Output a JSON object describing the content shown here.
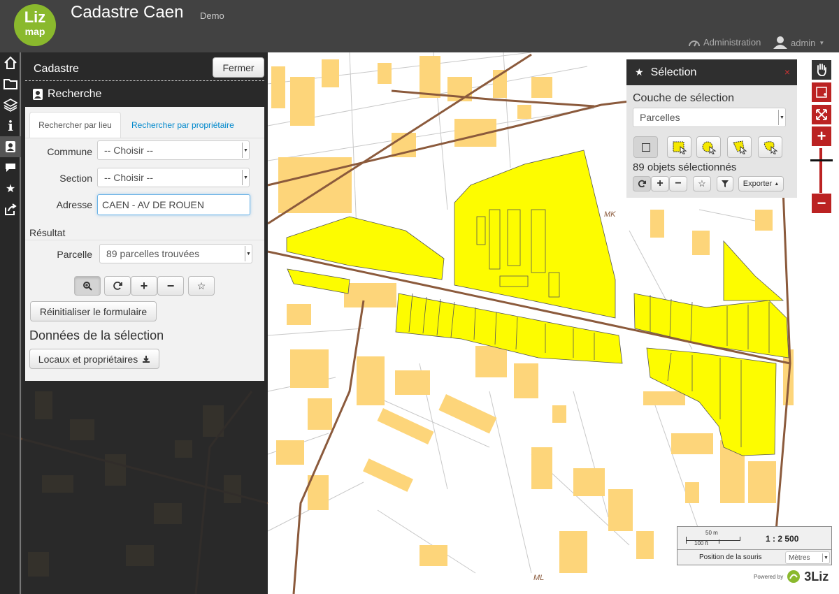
{
  "app": {
    "title": "Cadastre Caen",
    "subtitle": "Demo",
    "logo_top": "Liz",
    "logo_bottom": "map"
  },
  "header": {
    "admin_label": "Administration",
    "user_label": "admin"
  },
  "sidebar": {
    "items": [
      {
        "icon": "home-icon"
      },
      {
        "icon": "folder-icon"
      },
      {
        "icon": "layers-icon"
      },
      {
        "icon": "info-icon"
      },
      {
        "icon": "contact-icon",
        "active": true
      },
      {
        "icon": "comment-icon"
      },
      {
        "icon": "star-icon"
      },
      {
        "icon": "share-icon"
      }
    ]
  },
  "dock": {
    "title": "Cadastre",
    "close_label": "Fermer",
    "search_title": "Recherche",
    "tabs": [
      "Rechercher par lieu",
      "Rechercher par propriétaire"
    ],
    "commune": {
      "label": "Commune",
      "value": "-- Choisir --"
    },
    "section": {
      "label": "Section",
      "value": "-- Choisir --"
    },
    "adresse": {
      "label": "Adresse",
      "value": "CAEN - AV DE ROUEN"
    },
    "result_title": "Résultat",
    "parcelle": {
      "label": "Parcelle",
      "value": "89 parcelles trouvées"
    },
    "reset_label": "Réinitialiser le formulaire",
    "selection_title": "Données de la sélection",
    "export_label": "Locaux et propriétaires"
  },
  "selection_panel": {
    "title": "Sélection",
    "close_symbol": "×",
    "layer_label": "Couche de sélection",
    "layer_value": "Parcelles",
    "count_text": "89 objets sélectionnés",
    "export_label": "Exporter"
  },
  "map": {
    "scale_label": "1 : 2 500",
    "scale_metric": "50 m",
    "scale_imperial": "100 ft",
    "mouse_position_label": "Position de la souris",
    "units_value": "Mètres",
    "section_labels": [
      "MK",
      "ML"
    ],
    "colors": {
      "building": "#fdd57a",
      "selected_parcel": "#fdfc00",
      "road": "#8b5a3c",
      "dimmed_overlay": "rgba(40,40,40,0.82)"
    }
  },
  "footer": {
    "powered_by": "Powered by",
    "brand": "3Liz"
  }
}
